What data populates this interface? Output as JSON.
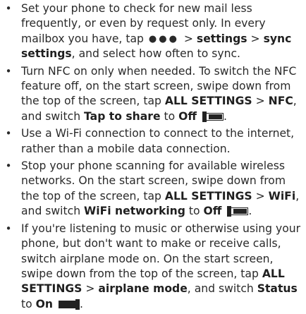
{
  "tips": [
    {
      "bullet": "•",
      "t1": "Set your phone to check for new mail less frequently, or even by request only. In every mailbox you have, tap",
      "dots_icon": "more-dots-icon",
      "t2": " > ",
      "b1": "settings",
      "t3": " > ",
      "b2": "sync settings",
      "t4": ", and select how often to sync."
    },
    {
      "bullet": "•",
      "t1": "Turn NFC on only when needed. To switch the NFC feature off, on the start screen, swipe down from the top of the screen, tap ",
      "b1": "ALL SETTINGS",
      "t2": " > ",
      "b2": "NFC",
      "t3": ", and switch ",
      "b3": "Tap to share",
      "t4": " to ",
      "b4": "Off",
      "t5": "."
    },
    {
      "bullet": "•",
      "t1": "Use a Wi-Fi connection to connect to the internet, rather than a mobile data connection."
    },
    {
      "bullet": "•",
      "t1": "Stop your phone scanning for available wireless networks. On the start screen, swipe down from the top of the screen, tap ",
      "b1": "ALL SETTINGS",
      "t2": " > ",
      "b2": "WiFi",
      "t3": ", and switch ",
      "b3": "WiFi networking",
      "t4": " to ",
      "b4": "Off",
      "t5": "."
    },
    {
      "bullet": "•",
      "t1": "If you're listening to music or otherwise using your phone, but don't want to make or receive calls, switch airplane mode on. On the start screen, swipe down from the top of the screen, tap ",
      "b1": "ALL SETTINGS",
      "t2": " > ",
      "b2": "airplane mode",
      "t3": ", and switch ",
      "b3": "Status",
      "t4": " to ",
      "b4": "On",
      "t5": "."
    }
  ]
}
